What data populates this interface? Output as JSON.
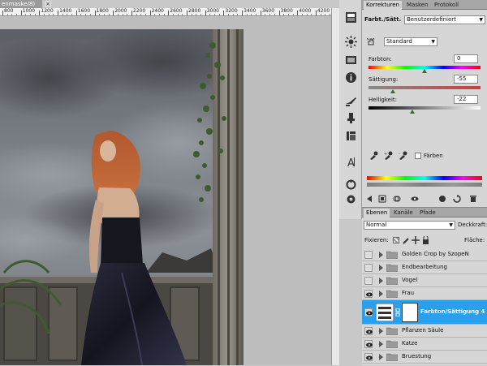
{
  "document": {
    "tab_title": "enmaske/8)",
    "close_glyph": "×",
    "ruler_labels": [
      "800",
      "1000",
      "1200",
      "1400",
      "1600",
      "1800",
      "2000",
      "2200",
      "2400",
      "2600",
      "2800",
      "3000",
      "3200",
      "3400",
      "3600",
      "3800",
      "4000",
      "4200"
    ]
  },
  "adjustments_panel": {
    "tabs": [
      "Korrekturen",
      "Masken",
      "Protokoll"
    ],
    "active_tab": 0,
    "header_label": "Farbt./Sätt.",
    "preset_value": "Benutzerdefiniert",
    "mode_value": "Standard",
    "hue": {
      "label": "Farbton:",
      "value": "0",
      "fraction": 0.5
    },
    "saturation": {
      "label": "Sättigung:",
      "value": "-55",
      "fraction": 0.22
    },
    "lightness": {
      "label": "Helligkeit:",
      "value": "-22",
      "fraction": 0.39
    },
    "colorize_label": "Färben",
    "colorize_checked": false
  },
  "layers_panel": {
    "tabs": [
      "Ebenen",
      "Kanäle",
      "Pfade"
    ],
    "active_tab": 0,
    "blend_mode": "Normal",
    "opacity_label": "Deckkraft:",
    "lock_label": "Fixieren:",
    "fill_label": "Fläche:",
    "layers": [
      {
        "name": "Golden Crop by SzopeN",
        "visible": false,
        "type": "group"
      },
      {
        "name": "Endbearbeitung",
        "visible": false,
        "type": "group"
      },
      {
        "name": "Vogel",
        "visible": false,
        "type": "group"
      },
      {
        "name": "Frau",
        "visible": true,
        "type": "group"
      },
      {
        "name": "Farbton/Sättigung 4",
        "visible": true,
        "type": "adjustment",
        "selected": true
      },
      {
        "name": "Pflanzen Säule",
        "visible": true,
        "type": "group"
      },
      {
        "name": "Katze",
        "visible": true,
        "type": "group"
      },
      {
        "name": "Bruestung",
        "visible": true,
        "type": "group"
      }
    ]
  },
  "icons": {
    "tool_strip": [
      "adjustments-icon",
      "styles-icon",
      "navigator-icon",
      "info-icon",
      "brush-presets-icon",
      "clone-source-icon",
      "tool-presets-icon",
      "character-icon",
      "paragraph-icon"
    ]
  }
}
